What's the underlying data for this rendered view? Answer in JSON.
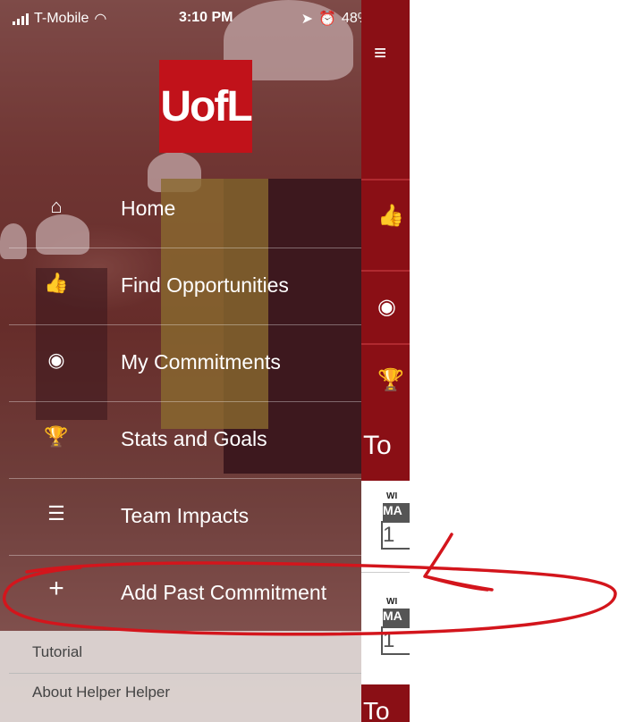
{
  "status_bar": {
    "carrier": "T-Mobile",
    "time": "3:10 PM",
    "battery": "48%"
  },
  "logo": {
    "text": "UofL"
  },
  "menu": {
    "items": [
      {
        "label": "Home",
        "icon": "home-icon"
      },
      {
        "label": "Find Opportunities",
        "icon": "thumbs-up-icon"
      },
      {
        "label": "My Commitments",
        "icon": "location-pin-icon"
      },
      {
        "label": "Stats and Goals",
        "icon": "trophy-icon"
      },
      {
        "label": "Team Impacts",
        "icon": "list-icon"
      },
      {
        "label": "Add Past Commitment",
        "icon": "plus-icon"
      }
    ],
    "secondary": [
      {
        "label": "Tutorial"
      },
      {
        "label": "About Helper Helper"
      }
    ]
  },
  "background_screen": {
    "today_label": "To",
    "cards": [
      {
        "weekday": "WI",
        "month": "MA",
        "day": "1"
      },
      {
        "weekday": "WI",
        "month": "MA",
        "day": "1"
      }
    ],
    "bottom_label": "To"
  },
  "colors": {
    "brand_red": "#c1121a",
    "annotation_red": "#d3151c"
  }
}
